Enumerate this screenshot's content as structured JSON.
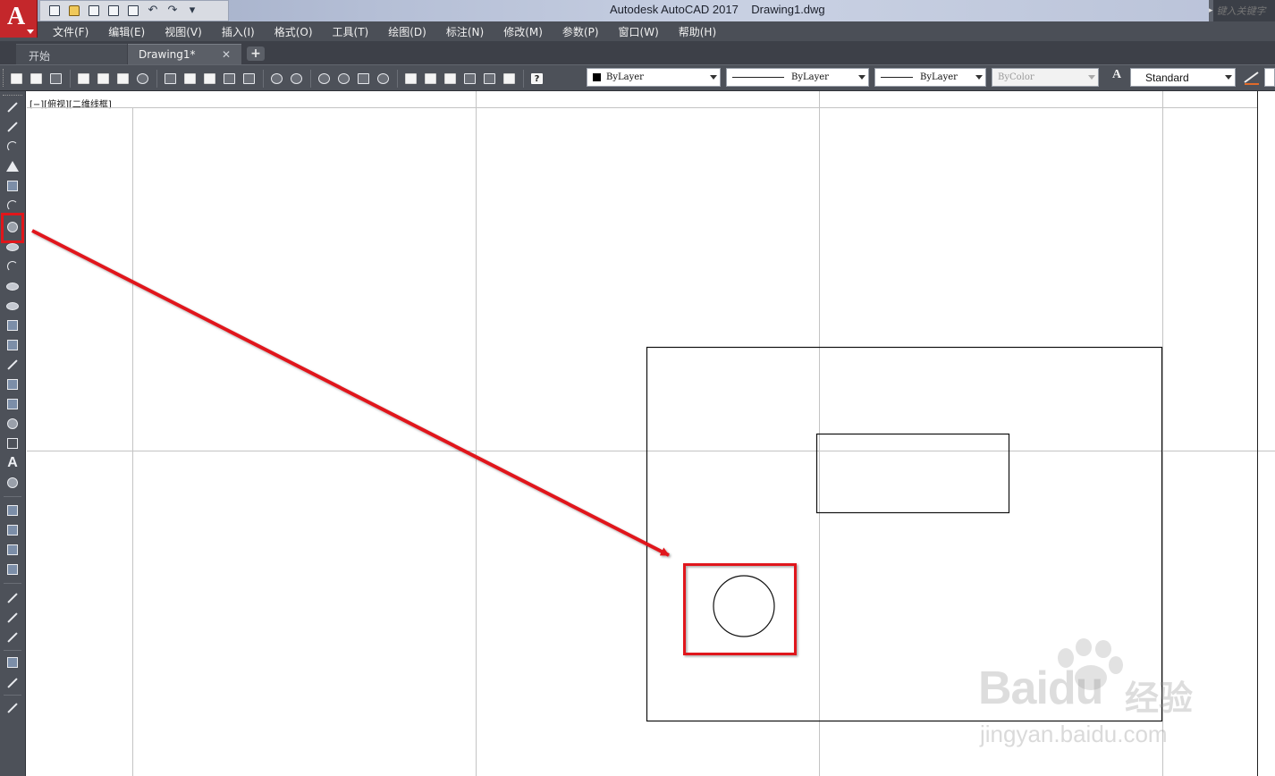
{
  "window": {
    "app_name": "Autodesk AutoCAD 2017",
    "file_name": "Drawing1.dwg",
    "logo_letter": "A",
    "search_placeholder": "键入关键字"
  },
  "menu": [
    "文件(F)",
    "编辑(E)",
    "视图(V)",
    "插入(I)",
    "格式(O)",
    "工具(T)",
    "绘图(D)",
    "标注(N)",
    "修改(M)",
    "参数(P)",
    "窗口(W)",
    "帮助(H)"
  ],
  "tabs": {
    "start_label": "开始",
    "drawing_label": "Drawing1*",
    "close_glyph": "✕",
    "add_glyph": "+"
  },
  "properties": {
    "color": "ByLayer",
    "linetype": "ByLayer",
    "lineweight": "ByLayer",
    "plotstyle": "ByColor",
    "text_style": "Standard"
  },
  "viewport": {
    "label": "[−][俯视][二维线框]"
  },
  "watermark": {
    "brand": "Baidu",
    "cn": "经验",
    "domain": "jingyan.baidu.com"
  },
  "colors": {
    "highlight": "#e0161b",
    "titlebar": "#b5bfd6",
    "ui_dark": "#4d5159",
    "canvas": "#ffffff",
    "logo": "#c4272b"
  },
  "icons": {
    "quick_access": [
      "new-icon",
      "open-icon",
      "save-icon",
      "save-as-icon",
      "plot-icon",
      "undo-icon",
      "redo-icon",
      "dropdown-icon"
    ],
    "standard_toolbar": [
      "qnew-icon",
      "open-icon",
      "save-icon",
      "plot-icon",
      "preview-icon",
      "publish-icon",
      "render-icon",
      "cut-icon",
      "copy-icon",
      "paste-icon",
      "match-properties-icon",
      "block-editor-icon",
      "undo-icon",
      "redo-icon",
      "pan-icon",
      "zoom-realtime-icon",
      "zoom-window-icon",
      "zoom-previous-icon",
      "properties-icon",
      "design-center-icon",
      "tool-palettes-icon",
      "sheet-set-icon",
      "markup-icon",
      "calculator-icon",
      "help-icon"
    ],
    "draw_toolbar": [
      "line-icon",
      "construction-line-icon",
      "polyline-icon",
      "polygon-icon",
      "rectangle-icon",
      "arc-icon",
      "circle-icon",
      "revision-cloud-icon",
      "spline-icon",
      "ellipse-icon",
      "ellipse-arc-icon",
      "insert-block-icon",
      "make-block-icon",
      "point-icon",
      "hatch-icon",
      "gradient-icon",
      "region-icon",
      "table-icon",
      "multiline-text-icon",
      "add-selected-icon",
      "layer-properties-icon",
      "layer-state-icon",
      "layer-previous-icon",
      "layer-isolate-icon",
      "dim-linear-icon",
      "dim-aligned-icon",
      "dim-arc-icon",
      "dim-ordinate-icon",
      "dim-radius-icon",
      "dim-jogged-icon"
    ]
  }
}
